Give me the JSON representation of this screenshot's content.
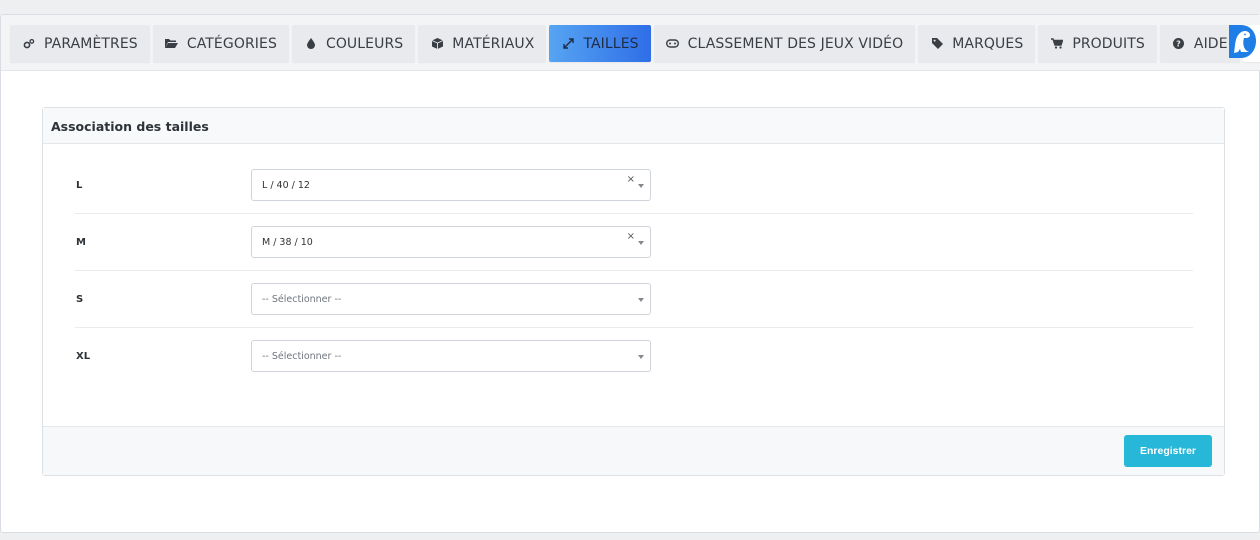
{
  "tabs": [
    {
      "label": "PARAMÈTRES",
      "icon": "gears-icon",
      "active": false
    },
    {
      "label": "CATÉGORIES",
      "icon": "folder-open-icon",
      "active": false
    },
    {
      "label": "COULEURS",
      "icon": "droplet-icon",
      "active": false
    },
    {
      "label": "MATÉRIAUX",
      "icon": "cube-icon",
      "active": false
    },
    {
      "label": "TAILLES",
      "icon": "expand-arrows-icon",
      "active": true
    },
    {
      "label": "CLASSEMENT DES JEUX VIDÉO",
      "icon": "gamepad-icon",
      "active": false
    },
    {
      "label": "MARQUES",
      "icon": "tag-icon",
      "active": false
    },
    {
      "label": "PRODUITS",
      "icon": "cart-icon",
      "active": false
    },
    {
      "label": "AIDE",
      "icon": "question-circle-icon",
      "active": false
    }
  ],
  "colors": {
    "active_tab_start": "#56a4f2",
    "active_tab_end": "#2f6ee8",
    "logo": "#1e7ee6",
    "save_button": "#26b7d9"
  },
  "card": {
    "title": "Association des tailles",
    "rows": [
      {
        "label": "L",
        "value": "L / 40 / 12",
        "placeholder": false,
        "clearable": true
      },
      {
        "label": "M",
        "value": "M / 38 / 10",
        "placeholder": false,
        "clearable": true
      },
      {
        "label": "S",
        "value": "-- Sélectionner --",
        "placeholder": true,
        "clearable": false
      },
      {
        "label": "XL",
        "value": "-- Sélectionner --",
        "placeholder": true,
        "clearable": false
      }
    ],
    "clear_symbol": "×",
    "save_label": "Enregistrer"
  }
}
